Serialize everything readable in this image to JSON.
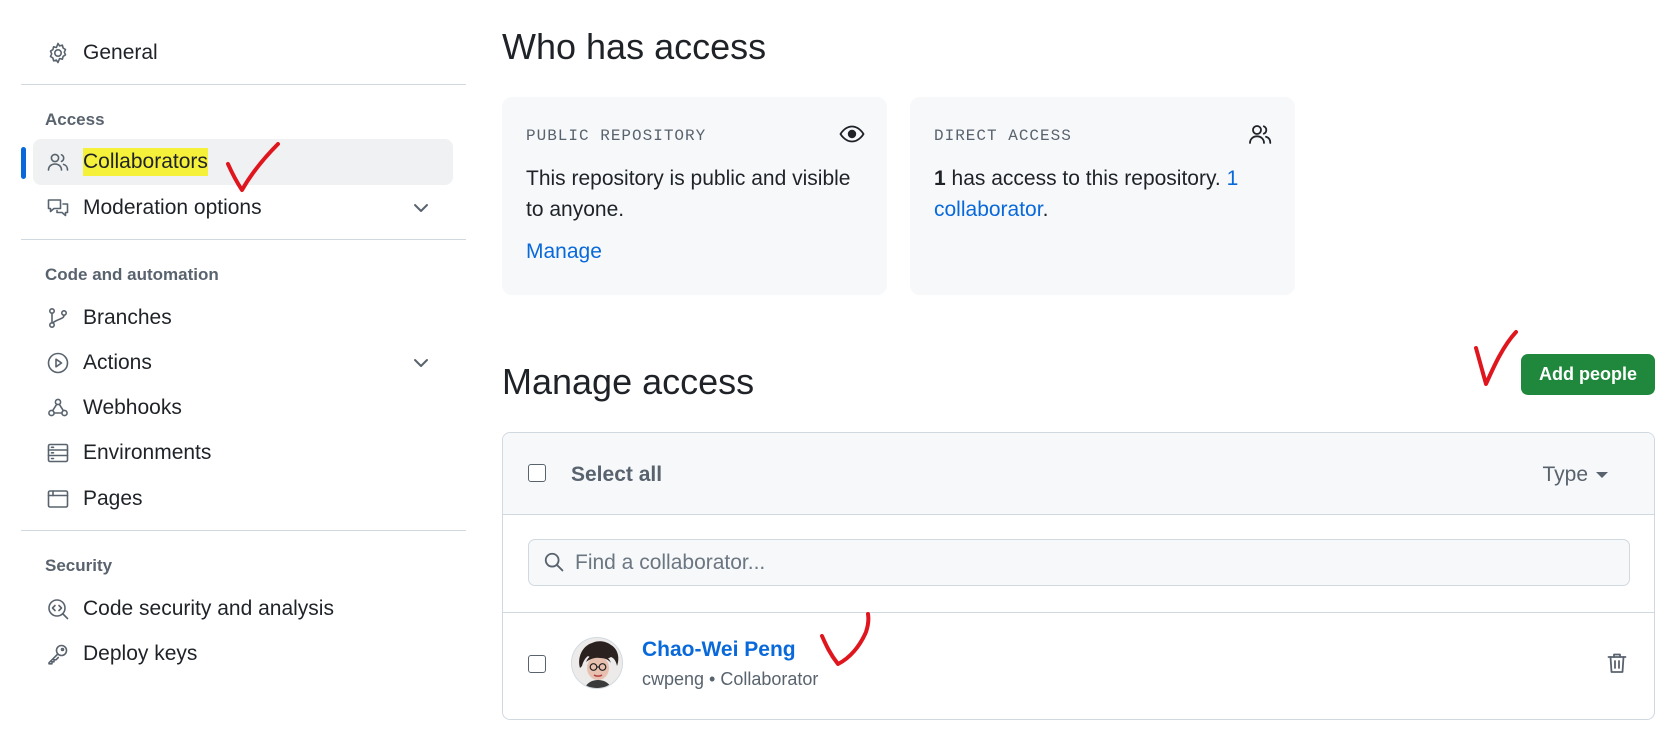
{
  "sidebar": {
    "general": "General",
    "sections": {
      "access": "Access",
      "code_automation": "Code and automation",
      "security": "Security"
    },
    "items": {
      "collaborators": "Collaborators",
      "moderation": "Moderation options",
      "branches": "Branches",
      "actions": "Actions",
      "webhooks": "Webhooks",
      "environments": "Environments",
      "pages": "Pages",
      "code_security": "Code security and analysis",
      "deploy_keys": "Deploy keys"
    },
    "active_item": "Collaborators"
  },
  "who_has_access": {
    "title": "Who has access",
    "public_card": {
      "label": "PUBLIC REPOSITORY",
      "text": "This repository is public and visible to anyone.",
      "link": "Manage",
      "icon": "eye-icon"
    },
    "direct_card": {
      "label": "DIRECT ACCESS",
      "count": "1",
      "text_middle": " has access to this repository. ",
      "link": "1 collaborator",
      "period": ".",
      "icon": "people-icon"
    }
  },
  "manage_access": {
    "title": "Manage access",
    "add_button": "Add people",
    "select_all": "Select all",
    "type_filter": "Type",
    "search_placeholder": "Find a collaborator...",
    "collaborators": [
      {
        "name": "Chao-Wei Peng",
        "meta": "cwpeng • Collaborator"
      }
    ]
  },
  "colors": {
    "accent": "#0969da",
    "primary_button": "#1f883d",
    "highlight": "#f5f03a",
    "annotation": "#e0161e"
  }
}
